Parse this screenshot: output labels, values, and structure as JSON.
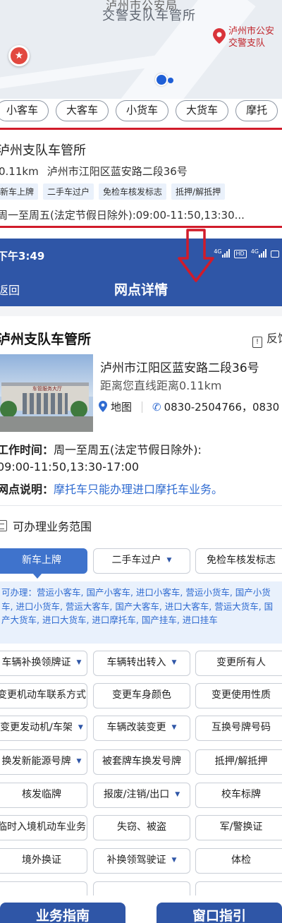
{
  "map": {
    "label_top": "泸州市公安局",
    "label_main": "交警支队车管所",
    "right_label_line1": "泸州市公安",
    "right_label_line2": "交警支队"
  },
  "vehicle_types": [
    "小客车",
    "大客车",
    "小货车",
    "大货车",
    "摩托"
  ],
  "preview_card": {
    "title": "泸州支队车管所",
    "distance": "0.11km",
    "address": "泸州市江阳区蓝安路二段36号",
    "tags": [
      "新车上牌",
      "二手车过户",
      "免检车核发标志",
      "抵押/解抵押"
    ],
    "hours": "周一至周五(法定节假日除外):09:00-11:50,13:30..."
  },
  "status_bar": {
    "time": "下午3:49",
    "signal1": "4G",
    "hd": "HD",
    "signal2": "4G"
  },
  "header": {
    "back_label": "返回",
    "title": "网点详情"
  },
  "detail": {
    "title": "泸州支队车管所",
    "feedback": "反馈",
    "photo_sign": "车管服务大厅",
    "address": "泸州市江阳区蓝安路二段36号",
    "distance_text": "距离您直线距离0.11km",
    "map_label": "地图",
    "phone": "0830-2504766，0830",
    "worktime_label": "工作时间：",
    "worktime_value": "周一至周五(法定节假日除外):",
    "worktime_value2": "09:00-11:50,13:30-17:00",
    "note_label": "网点说明：",
    "note_value": "摩托车只能办理进口摩托车业务。"
  },
  "scope": {
    "title": "可办理业务范围",
    "services": [
      "新车上牌",
      "二手车过户",
      "免检车核发标志",
      "车辆补换领牌证",
      "车辆转出转入",
      "变更所有人",
      "变更机动车联系方式",
      "变更车身颜色",
      "变更使用性质",
      "变更发动机/车架",
      "车辆改装变更",
      "互换号牌号码",
      "换发新能源号牌",
      "被套牌车换发号牌",
      "抵押/解抵押",
      "核发临牌",
      "报废/注销/出口",
      "校车标牌",
      "临时入境机动车业务",
      "失窃、被盗",
      "军/警换证",
      "境外换证",
      "补换领驾驶证",
      "体检"
    ],
    "detail_text": "可办理：营运小客车, 国产小客车, 进口小客车, 营运小货车, 国产小货车, 进口小货车, 营运大客车, 国产大客车, 进口大客车, 营运大货车, 国产大货车, 进口大货车, 进口摩托车, 国产挂车, 进口挂车"
  },
  "bottom": {
    "guide_label": "业务指南",
    "window_label": "窗口指引"
  },
  "colors": {
    "primary": "#2f56a7",
    "accent": "#3f73cc",
    "highlight_red": "#d11b2a"
  }
}
